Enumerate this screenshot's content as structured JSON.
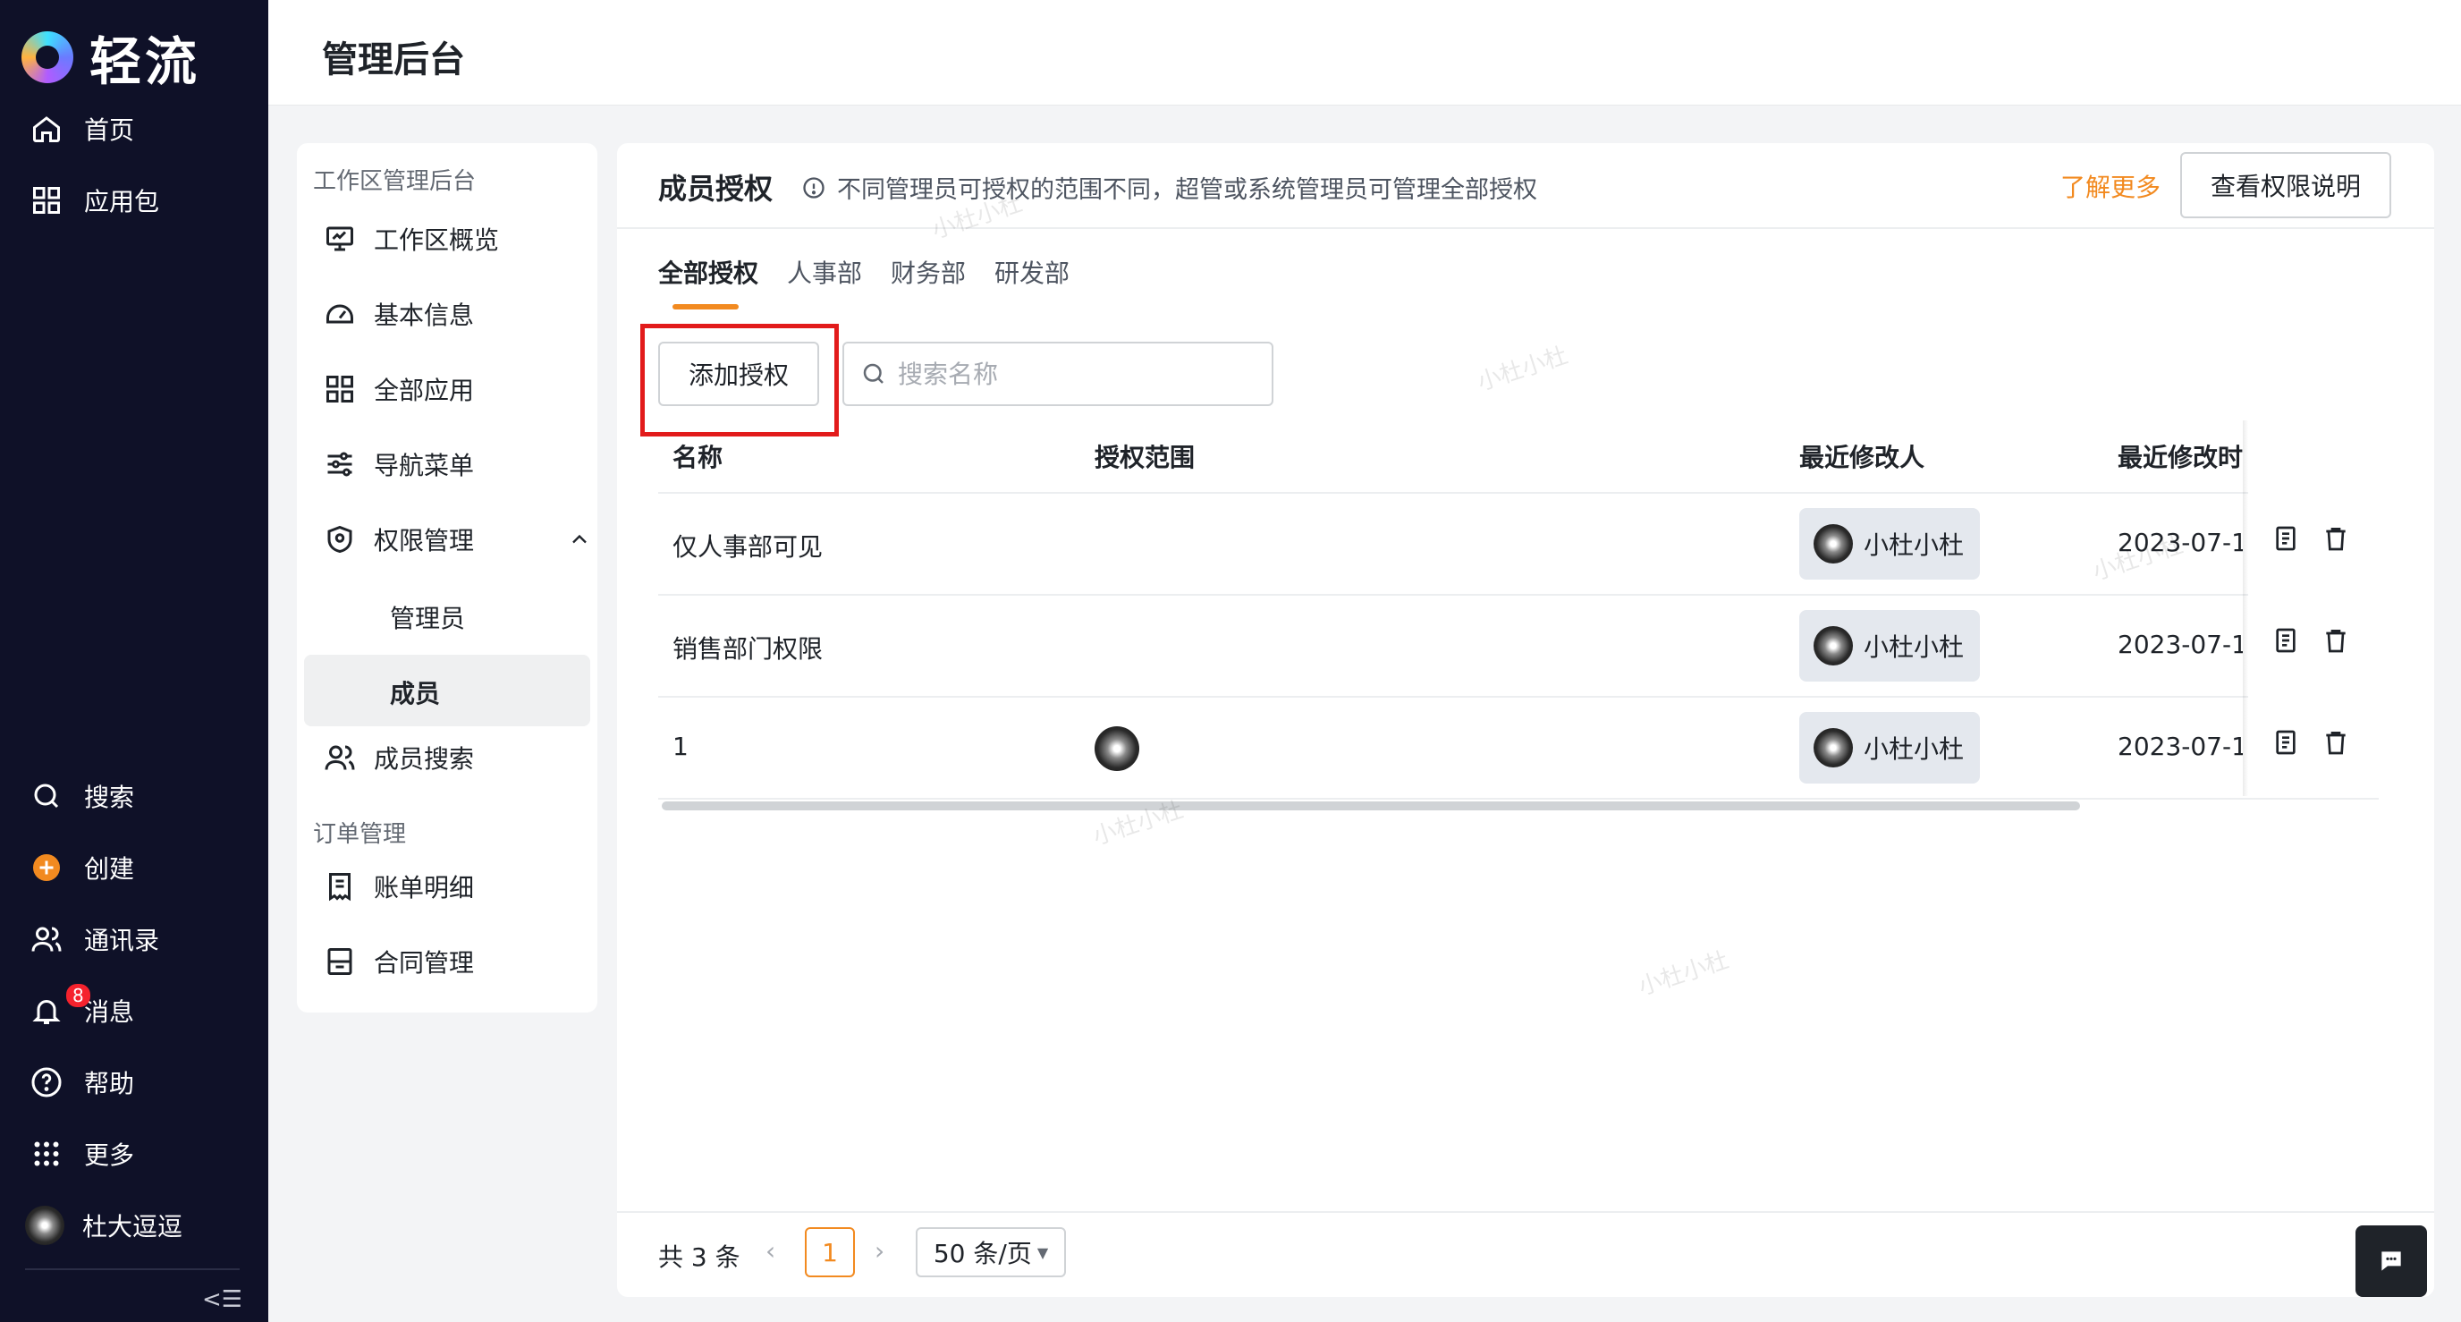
{
  "app": {
    "name": "轻流"
  },
  "nav": {
    "top_items": [
      {
        "label": "首页",
        "icon": "home-icon"
      },
      {
        "label": "应用包",
        "icon": "grid-icon"
      }
    ],
    "bottom_items": [
      {
        "label": "搜索",
        "icon": "search-icon"
      },
      {
        "label": "创建",
        "icon": "plus-circle-icon"
      },
      {
        "label": "通讯录",
        "icon": "contacts-icon"
      },
      {
        "label": "消息",
        "icon": "bell-icon",
        "badge": "8"
      },
      {
        "label": "帮助",
        "icon": "help-icon"
      },
      {
        "label": "更多",
        "icon": "dots-grid-icon"
      }
    ],
    "user": {
      "name": "杜大逗逗"
    }
  },
  "header": {
    "title": "管理后台"
  },
  "submenu": {
    "group1_title": "工作区管理后台",
    "items": [
      {
        "label": "工作区概览",
        "icon": "monitor-icon"
      },
      {
        "label": "基本信息",
        "icon": "gauge-icon"
      },
      {
        "label": "全部应用",
        "icon": "grid-icon"
      },
      {
        "label": "导航菜单",
        "icon": "sliders-icon"
      },
      {
        "label": "权限管理",
        "icon": "shield-icon"
      }
    ],
    "sub_items": [
      {
        "label": "管理员"
      },
      {
        "label": "成员"
      }
    ],
    "member_search": "成员搜索",
    "group2_title": "订单管理",
    "order_items": [
      {
        "label": "账单明细",
        "icon": "bill-icon"
      },
      {
        "label": "合同管理",
        "icon": "contract-icon"
      }
    ]
  },
  "main": {
    "title": "成员授权",
    "hint": "不同管理员可授权的范围不同，超管或系统管理员可管理全部授权",
    "learn_more": "了解更多",
    "view_button": "查看权限说明",
    "tabs": [
      "全部授权",
      "人事部",
      "财务部",
      "研发部"
    ],
    "add_button": "添加授权",
    "search_placeholder": "搜索名称",
    "columns": [
      "名称",
      "授权范围",
      "最近修改人",
      "最近修改时间"
    ],
    "rows": [
      {
        "name": "仅人事部可见",
        "modifier": "小杜小杜",
        "time": "2023-07-1"
      },
      {
        "name": "销售部门权限",
        "modifier": "小杜小杜",
        "time": "2023-07-1"
      },
      {
        "name": "1",
        "modifier": "小杜小杜",
        "time": "2023-07-1"
      }
    ],
    "pagination": {
      "total": "共 3 条",
      "current": "1",
      "page_size": "50 条/页"
    }
  },
  "watermark": "小杜小杜",
  "colors": {
    "accent": "#f28a20",
    "nav_bg": "#0f1128",
    "highlight": "#e21b1b"
  }
}
